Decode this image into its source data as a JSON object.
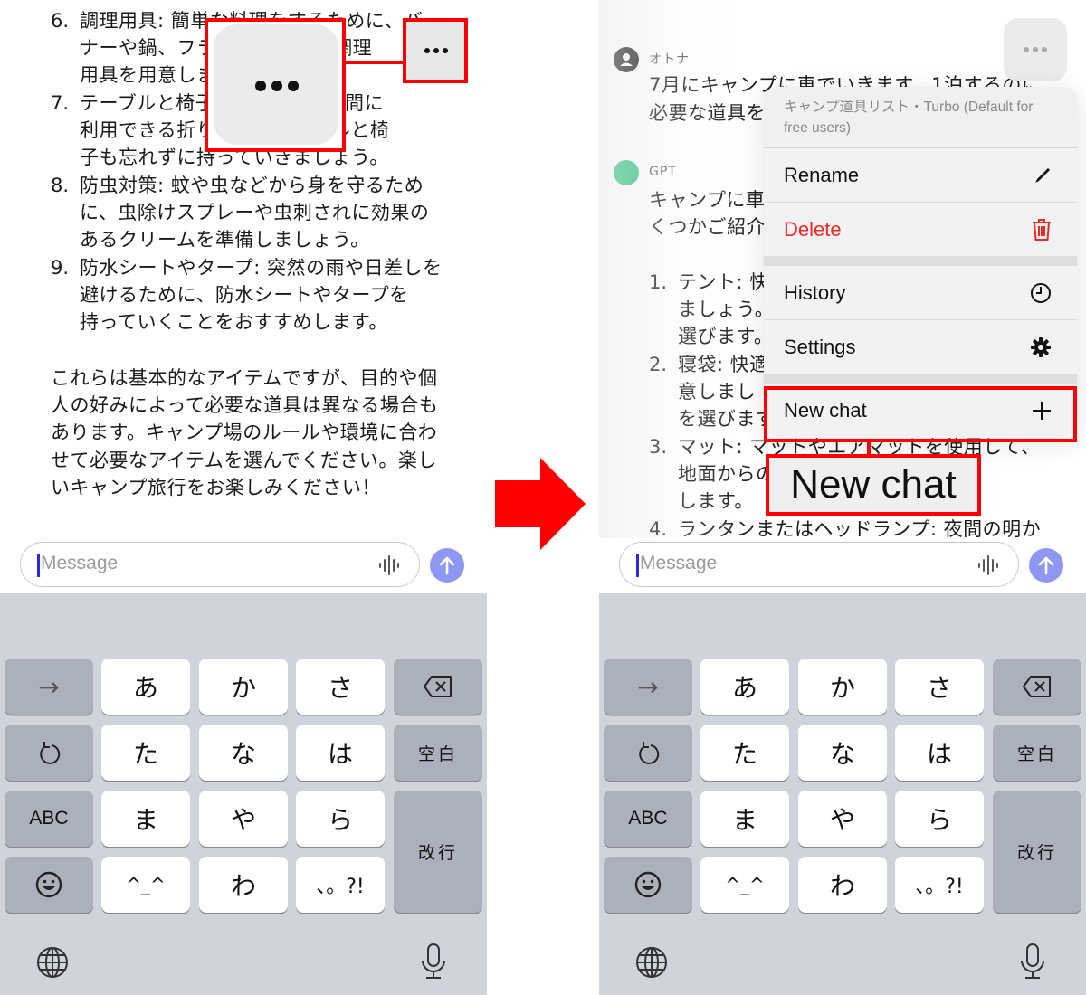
{
  "left_panel": {
    "list_items": [
      {
        "number": "6.",
        "lines": [
          "調理用具: 簡単な料理をするために、バー",
          "ナーや鍋、フライパンなどの調理",
          "用具を用意しましょう。"
        ]
      },
      {
        "number": "7.",
        "lines": [
          "テーブルと椅子: くつろぎの時間に",
          "利用できる折りたたみテーブルと椅",
          "子も忘れずに持っていきましょう。"
        ]
      },
      {
        "number": "8.",
        "lines": [
          "防虫対策: 蚊や虫などから身を守るため",
          "に、虫除けスプレーや虫刺されに効果の",
          "あるクリームを準備しましょう。"
        ]
      },
      {
        "number": "9.",
        "lines": [
          "防水シートやタープ: 突然の雨や日差しを",
          "避けるために、防水シートやタープを",
          "持っていくことをおすすめします。"
        ]
      }
    ],
    "closing_paragraph": [
      "これらは基本的なアイテムですが、目的や個",
      "人の好みによって必要な道具は異なる場合も",
      "あります。キャンプ場のルールや環境に合わ",
      "せて必要なアイテムを選んでください。楽し",
      "いキャンプ旅行をお楽しみください！"
    ],
    "more_button_icon": "ellipsis-icon",
    "magnified_more_button_icon": "ellipsis-icon"
  },
  "right_panel": {
    "user_name": "オトナ",
    "user_message_lines": [
      "7月にキャンプに車でいきます。1泊するのに",
      "必要な道具を"
    ],
    "assistant_name": "GPT",
    "assistant_intro_lines": [
      "キャンプに車",
      "くつかご紹介"
    ],
    "assistant_list": [
      {
        "number": "1.",
        "lines": [
          "テント: 快",
          "ましょう。",
          "選びます。"
        ]
      },
      {
        "number": "2.",
        "lines": [
          "寝袋: 快適",
          "意しまし",
          "を選びます"
        ]
      },
      {
        "number": "3.",
        "lines": [
          "マット: マットやエアマットを使用して、",
          "地面からの",
          "します。"
        ]
      },
      {
        "number": "4.",
        "lines": [
          "ランタンまたはヘッドランプ: 夜間の明か"
        ]
      }
    ],
    "menu": {
      "header": "キャンプ道具リスト・Turbo (Default for free users)",
      "items": [
        {
          "label": "Rename",
          "icon": "pencil-icon"
        },
        {
          "label": "Delete",
          "icon": "trash-icon",
          "color": "#ee2a24"
        },
        {
          "label": "History",
          "icon": "clock-icon"
        },
        {
          "label": "Settings",
          "icon": "gear-icon"
        },
        {
          "label": "New chat",
          "icon": "plus-icon"
        }
      ]
    },
    "callout_label": "New chat"
  },
  "composer": {
    "placeholder": "Message",
    "voice_icon": "waveform-icon",
    "send_icon": "arrow-up-icon"
  },
  "keyboard": {
    "rows": [
      [
        "→",
        "あ",
        "か",
        "さ",
        "⌫"
      ],
      [
        "↺",
        "た",
        "な",
        "は",
        "空白"
      ],
      [
        "ABC",
        "ま",
        "や",
        "ら",
        "改行"
      ],
      [
        "☺",
        "^_^",
        "わ",
        "、。?!"
      ]
    ],
    "next_label": "→",
    "kana": [
      "あ",
      "か",
      "さ",
      "た",
      "な",
      "は",
      "ま",
      "や",
      "ら",
      "^_^",
      "わ",
      "、。?!"
    ],
    "space_label": "空白",
    "return_label": "改行",
    "abc_label": "ABC"
  },
  "colors": {
    "annotation_red": "#ff0000",
    "send_button": "#8e97f2",
    "gpt_avatar": "#1fbf7a",
    "danger": "#ee2a24",
    "keyboard_bg": "#d1d3da"
  }
}
